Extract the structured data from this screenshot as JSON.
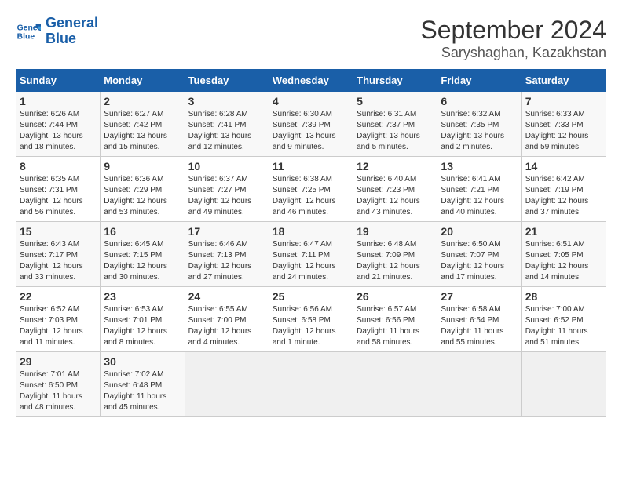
{
  "header": {
    "logo_line1": "General",
    "logo_line2": "Blue",
    "title": "September 2024",
    "subtitle": "Saryshaghan, Kazakhstan"
  },
  "calendar": {
    "days_of_week": [
      "Sunday",
      "Monday",
      "Tuesday",
      "Wednesday",
      "Thursday",
      "Friday",
      "Saturday"
    ],
    "weeks": [
      [
        {
          "day": "",
          "empty": true
        },
        {
          "day": "",
          "empty": true
        },
        {
          "day": "",
          "empty": true
        },
        {
          "day": "",
          "empty": true
        },
        {
          "day": "5",
          "sunrise": "6:31 AM",
          "sunset": "7:37 PM",
          "daylight": "13 hours and 5 minutes."
        },
        {
          "day": "6",
          "sunrise": "6:32 AM",
          "sunset": "7:35 PM",
          "daylight": "13 hours and 2 minutes."
        },
        {
          "day": "7",
          "sunrise": "6:33 AM",
          "sunset": "7:33 PM",
          "daylight": "12 hours and 59 minutes."
        }
      ],
      [
        {
          "day": "1",
          "sunrise": "6:26 AM",
          "sunset": "7:44 PM",
          "daylight": "13 hours and 18 minutes."
        },
        {
          "day": "2",
          "sunrise": "6:27 AM",
          "sunset": "7:42 PM",
          "daylight": "13 hours and 15 minutes."
        },
        {
          "day": "3",
          "sunrise": "6:28 AM",
          "sunset": "7:41 PM",
          "daylight": "13 hours and 12 minutes."
        },
        {
          "day": "4",
          "sunrise": "6:30 AM",
          "sunset": "7:39 PM",
          "daylight": "13 hours and 9 minutes."
        },
        {
          "day": "5",
          "sunrise": "6:31 AM",
          "sunset": "7:37 PM",
          "daylight": "13 hours and 5 minutes."
        },
        {
          "day": "6",
          "sunrise": "6:32 AM",
          "sunset": "7:35 PM",
          "daylight": "13 hours and 2 minutes."
        },
        {
          "day": "7",
          "sunrise": "6:33 AM",
          "sunset": "7:33 PM",
          "daylight": "12 hours and 59 minutes."
        }
      ],
      [
        {
          "day": "8",
          "sunrise": "6:35 AM",
          "sunset": "7:31 PM",
          "daylight": "12 hours and 56 minutes."
        },
        {
          "day": "9",
          "sunrise": "6:36 AM",
          "sunset": "7:29 PM",
          "daylight": "12 hours and 53 minutes."
        },
        {
          "day": "10",
          "sunrise": "6:37 AM",
          "sunset": "7:27 PM",
          "daylight": "12 hours and 49 minutes."
        },
        {
          "day": "11",
          "sunrise": "6:38 AM",
          "sunset": "7:25 PM",
          "daylight": "12 hours and 46 minutes."
        },
        {
          "day": "12",
          "sunrise": "6:40 AM",
          "sunset": "7:23 PM",
          "daylight": "12 hours and 43 minutes."
        },
        {
          "day": "13",
          "sunrise": "6:41 AM",
          "sunset": "7:21 PM",
          "daylight": "12 hours and 40 minutes."
        },
        {
          "day": "14",
          "sunrise": "6:42 AM",
          "sunset": "7:19 PM",
          "daylight": "12 hours and 37 minutes."
        }
      ],
      [
        {
          "day": "15",
          "sunrise": "6:43 AM",
          "sunset": "7:17 PM",
          "daylight": "12 hours and 33 minutes."
        },
        {
          "day": "16",
          "sunrise": "6:45 AM",
          "sunset": "7:15 PM",
          "daylight": "12 hours and 30 minutes."
        },
        {
          "day": "17",
          "sunrise": "6:46 AM",
          "sunset": "7:13 PM",
          "daylight": "12 hours and 27 minutes."
        },
        {
          "day": "18",
          "sunrise": "6:47 AM",
          "sunset": "7:11 PM",
          "daylight": "12 hours and 24 minutes."
        },
        {
          "day": "19",
          "sunrise": "6:48 AM",
          "sunset": "7:09 PM",
          "daylight": "12 hours and 21 minutes."
        },
        {
          "day": "20",
          "sunrise": "6:50 AM",
          "sunset": "7:07 PM",
          "daylight": "12 hours and 17 minutes."
        },
        {
          "day": "21",
          "sunrise": "6:51 AM",
          "sunset": "7:05 PM",
          "daylight": "12 hours and 14 minutes."
        }
      ],
      [
        {
          "day": "22",
          "sunrise": "6:52 AM",
          "sunset": "7:03 PM",
          "daylight": "12 hours and 11 minutes."
        },
        {
          "day": "23",
          "sunrise": "6:53 AM",
          "sunset": "7:01 PM",
          "daylight": "12 hours and 8 minutes."
        },
        {
          "day": "24",
          "sunrise": "6:55 AM",
          "sunset": "7:00 PM",
          "daylight": "12 hours and 4 minutes."
        },
        {
          "day": "25",
          "sunrise": "6:56 AM",
          "sunset": "6:58 PM",
          "daylight": "12 hours and 1 minute."
        },
        {
          "day": "26",
          "sunrise": "6:57 AM",
          "sunset": "6:56 PM",
          "daylight": "11 hours and 58 minutes."
        },
        {
          "day": "27",
          "sunrise": "6:58 AM",
          "sunset": "6:54 PM",
          "daylight": "11 hours and 55 minutes."
        },
        {
          "day": "28",
          "sunrise": "7:00 AM",
          "sunset": "6:52 PM",
          "daylight": "11 hours and 51 minutes."
        }
      ],
      [
        {
          "day": "29",
          "sunrise": "7:01 AM",
          "sunset": "6:50 PM",
          "daylight": "11 hours and 48 minutes."
        },
        {
          "day": "30",
          "sunrise": "7:02 AM",
          "sunset": "6:48 PM",
          "daylight": "11 hours and 45 minutes."
        },
        {
          "day": "",
          "empty": true
        },
        {
          "day": "",
          "empty": true
        },
        {
          "day": "",
          "empty": true
        },
        {
          "day": "",
          "empty": true
        },
        {
          "day": "",
          "empty": true
        }
      ]
    ]
  }
}
